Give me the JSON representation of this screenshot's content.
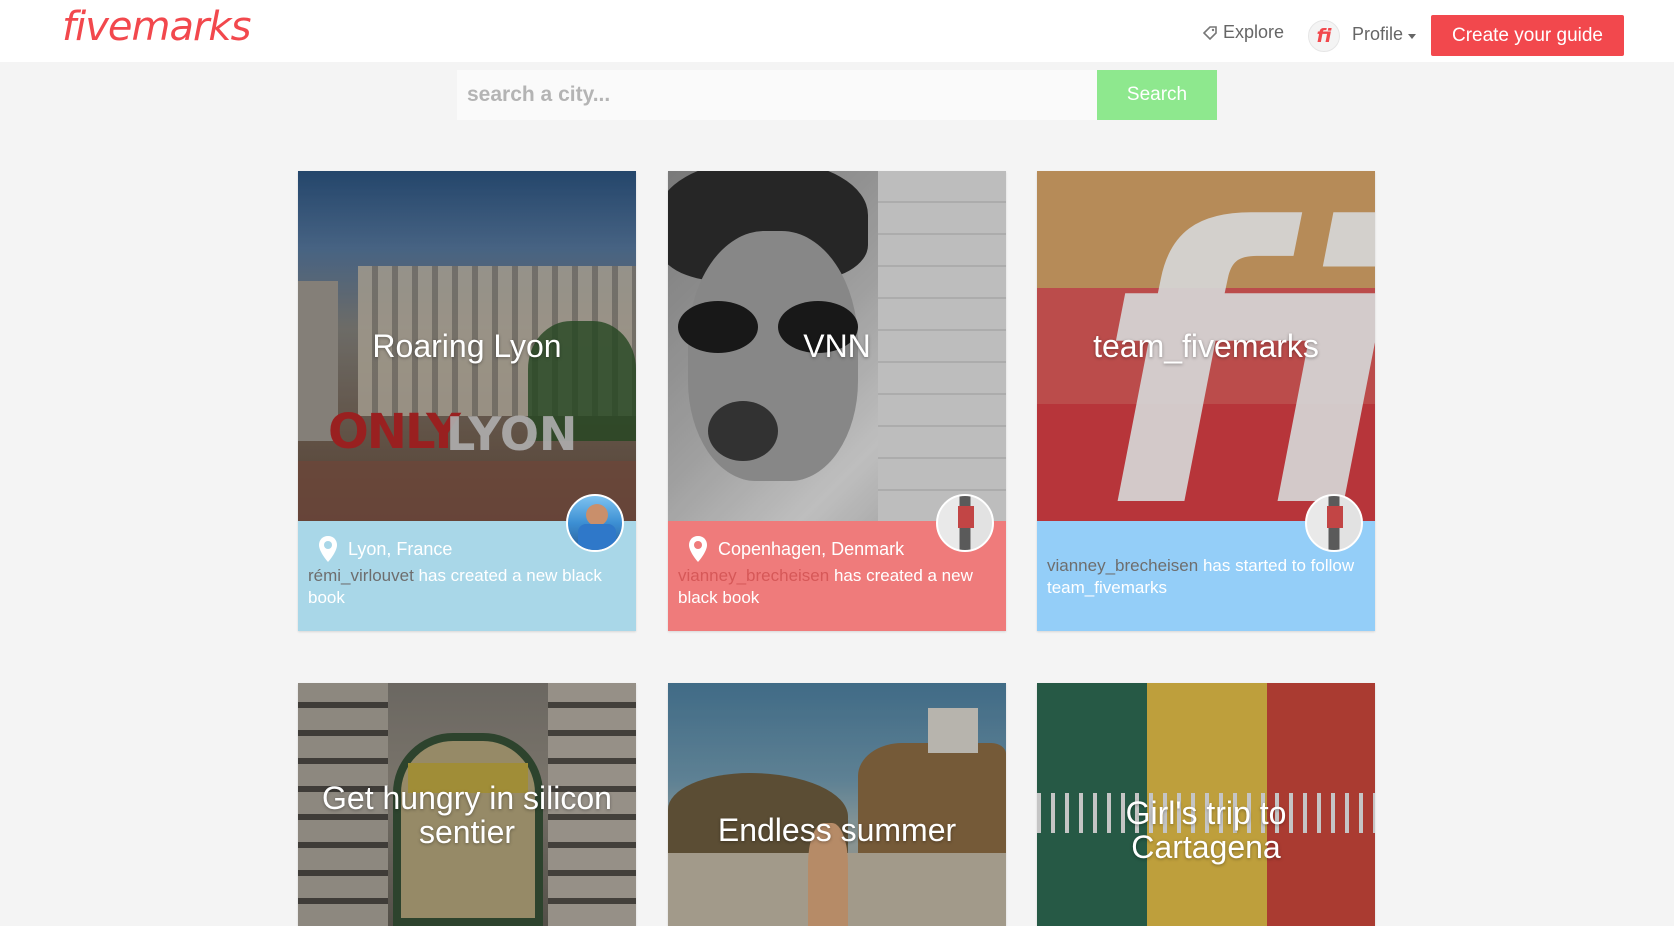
{
  "header": {
    "logo": "fivemarks",
    "nav_explore": "Explore",
    "nav_profile": "Profile",
    "avatar_initials": "fi",
    "create_button": "Create your guide"
  },
  "search": {
    "placeholder": "search a city...",
    "button": "Search"
  },
  "cards": [
    {
      "title": "Roaring Lyon",
      "location": "Lyon, France",
      "user": "rémi_virlouvet",
      "action": " has created a new black book",
      "footer_color": "#a9d7e8"
    },
    {
      "title": "VNN",
      "location": "Copenhagen, Denmark",
      "user": "vianney_brecheisen",
      "action": " has created a new black book",
      "footer_color": "#ef7b7b"
    },
    {
      "title": "team_fivemarks",
      "user": "vianney_brecheisen",
      "action": " has started to follow team_fivemarks",
      "footer_color": "#94cef8"
    },
    {
      "title": "Get hungry in silicon sentier"
    },
    {
      "title": "Endless summer"
    },
    {
      "title": "Girl's trip to Cartagena"
    }
  ],
  "colors": {
    "brand": "#f2484d",
    "search_button": "#8ee88e"
  }
}
